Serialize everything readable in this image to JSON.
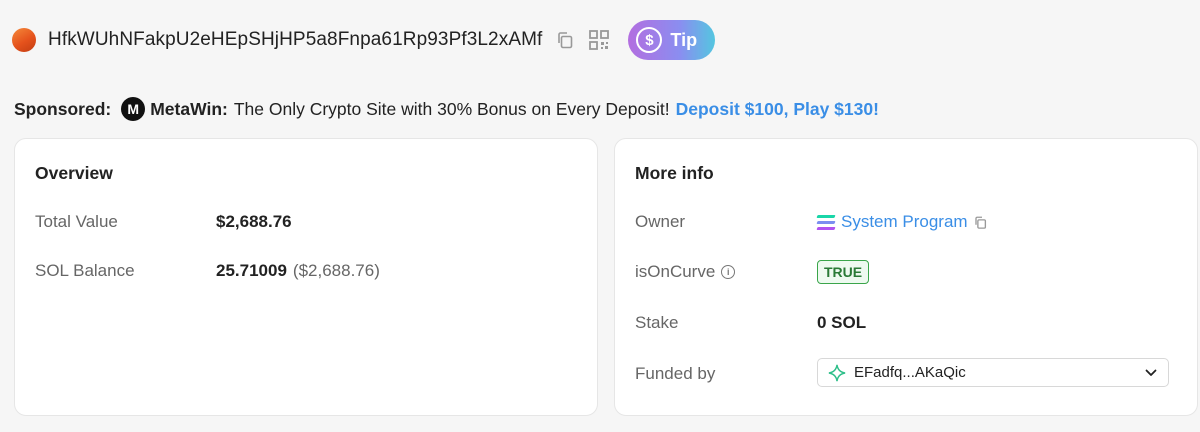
{
  "header": {
    "address": "HfkWUhNFakpU2eHEpSHjHP5a8Fnpa61Rp93Pf3L2xAMf",
    "tip_label": "Tip",
    "tip_icon": "dollar-coin-icon",
    "copy_icon": "copy-icon",
    "qr_icon": "qr-code-icon"
  },
  "sponsored": {
    "label": "Sponsored:",
    "brand": "MetaWin:",
    "brand_logo_letter": "M",
    "text": "The Only Crypto Site with 30% Bonus on Every Deposit!",
    "link": "Deposit $100, Play $130!"
  },
  "overview": {
    "title": "Overview",
    "total_value_label": "Total Value",
    "total_value": "$2,688.76",
    "sol_balance_label": "SOL Balance",
    "sol_balance": "25.71009",
    "sol_balance_usd": "($2,688.76)"
  },
  "more_info": {
    "title": "More info",
    "owner_label": "Owner",
    "owner_value": "System Program",
    "is_on_curve_label": "isOnCurve",
    "is_on_curve_value": "TRUE",
    "stake_label": "Stake",
    "stake_value": "0 SOL",
    "funded_by_label": "Funded by",
    "funded_by_value": "EFadfq...AKaQic"
  },
  "colors": {
    "link": "#3a8ee6",
    "badge_green": "#3aa54a",
    "tip_gradient_start": "#b36ee0",
    "tip_gradient_end": "#54c6e0"
  }
}
